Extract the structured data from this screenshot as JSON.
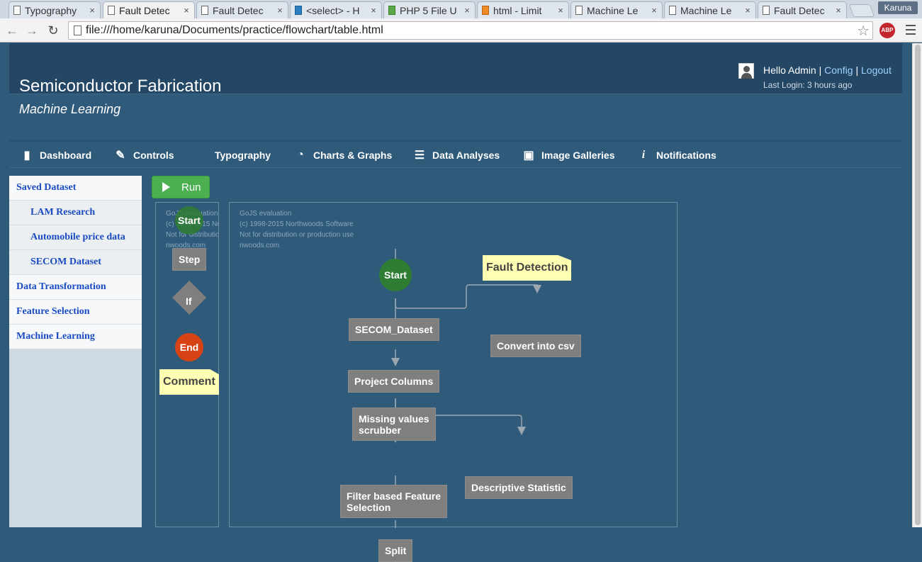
{
  "browser": {
    "tabs": [
      {
        "title": "Typography",
        "icon": "page-icon"
      },
      {
        "title": "Fault Detec",
        "icon": "page-icon",
        "active": true
      },
      {
        "title": "Fault Detec",
        "icon": "page-icon"
      },
      {
        "title": "<select> - H",
        "icon": "select-site-icon"
      },
      {
        "title": "PHP 5 File U",
        "icon": "w3-icon"
      },
      {
        "title": "html - Limit",
        "icon": "stackoverflow-icon"
      },
      {
        "title": "Machine Le",
        "icon": "page-icon"
      },
      {
        "title": "Machine Le",
        "icon": "page-icon"
      },
      {
        "title": "Fault Detec",
        "icon": "page-icon"
      }
    ],
    "tab_close": "×",
    "profile": "Karuna",
    "url": "file:///home/karuna/Documents/practice/flowchart/table.html",
    "adblock": "ABP"
  },
  "header": {
    "title": "Semiconductor Fabrication",
    "subtitle": "Machine Learning",
    "greeting": "Hello Admin",
    "sep1": " | ",
    "config": "Config",
    "sep2": " | ",
    "logout": "Logout",
    "last_login": "Last Login: 3 hours ago"
  },
  "nav": [
    {
      "label": "Dashboard",
      "icon": "bar-chart-icon"
    },
    {
      "label": "Controls",
      "icon": "edit-icon"
    },
    {
      "label": "Typography",
      "icon": ""
    },
    {
      "label": "Charts & Graphs",
      "icon": "pie-chart-icon"
    },
    {
      "label": "Data Analyses",
      "icon": "list-icon"
    },
    {
      "label": "Image Galleries",
      "icon": "image-icon"
    },
    {
      "label": "Notifications",
      "icon": "info-icon"
    }
  ],
  "sidebar": [
    {
      "label": "Saved Dataset",
      "level": "top"
    },
    {
      "label": "LAM Research",
      "level": "sub"
    },
    {
      "label": "Automobile price data",
      "level": "sub"
    },
    {
      "label": "SECOM Dataset",
      "level": "sub"
    },
    {
      "label": "Data Transformation",
      "level": "top"
    },
    {
      "label": "Feature Selection",
      "level": "top"
    },
    {
      "label": "Machine Learning",
      "level": "top"
    }
  ],
  "run_button": "Run",
  "watermark": {
    "line1": "GoJS evaluation",
    "line2": "(c) 1998-2015 Northwoods Software",
    "line3": "Not for distribution or production use",
    "line4": "nwoods.com"
  },
  "palette": {
    "start": "Start",
    "step": "Step",
    "if": "If",
    "end": "End",
    "comment": "Comment"
  },
  "diagram": {
    "start": "Start",
    "title_comment": "Fault Detection",
    "secom": "SECOM_Dataset",
    "convert": "Convert into csv",
    "project": "Project Columns",
    "missing1": "Missing values",
    "missing2": "scrubber",
    "descriptive": "Descriptive Statistic",
    "filter1": "Filter based Feature",
    "filter2": "Selection",
    "split": "Split"
  }
}
